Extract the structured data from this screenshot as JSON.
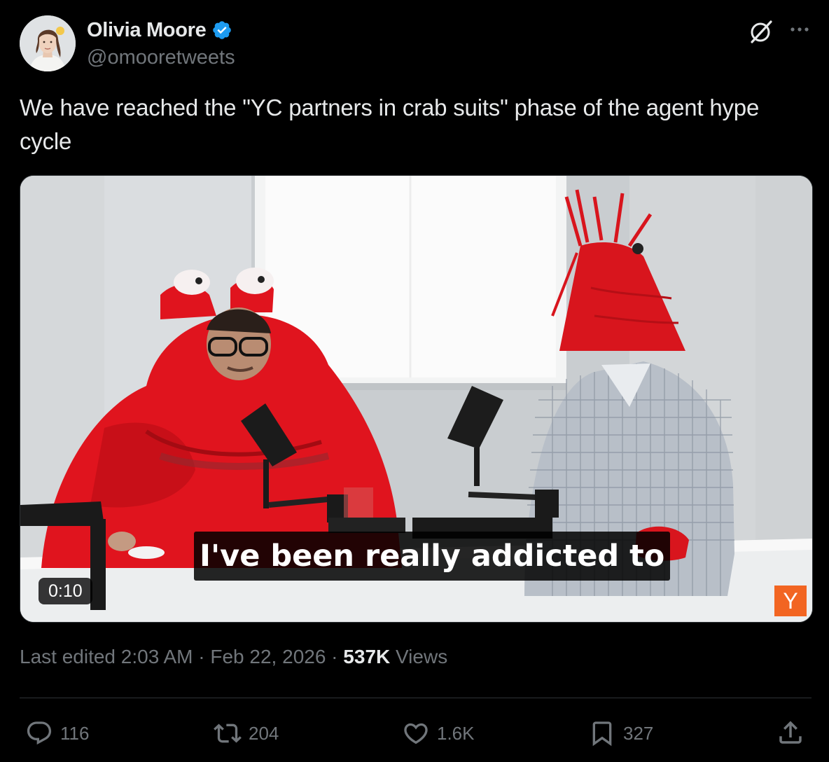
{
  "author": {
    "name": "Olivia Moore",
    "handle": "@omooretweets",
    "verified": true
  },
  "tweet": {
    "text": "We have reached the \"YC partners in crab suits\" phase of the agent hype cycle"
  },
  "media": {
    "caption": "I've been really addicted to",
    "duration": "0:10",
    "watermark": "Y"
  },
  "meta": {
    "edited": "Last edited 2:03 AM · Feb 22, 2026 · ",
    "views_count": "537K",
    "views_label": " Views"
  },
  "actions": {
    "replies": "116",
    "reposts": "204",
    "likes": "1.6K",
    "bookmarks": "327"
  },
  "icons": [
    "grok-icon",
    "more-icon",
    "reply-icon",
    "repost-icon",
    "like-icon",
    "bookmark-icon",
    "share-icon",
    "verified-icon"
  ],
  "colors": {
    "background": "#000000",
    "text": "#e7e9ea",
    "secondary": "#71767b",
    "verified": "#1d9bf0",
    "yc_orange": "#f26522",
    "crab_red": "#e0141e"
  }
}
